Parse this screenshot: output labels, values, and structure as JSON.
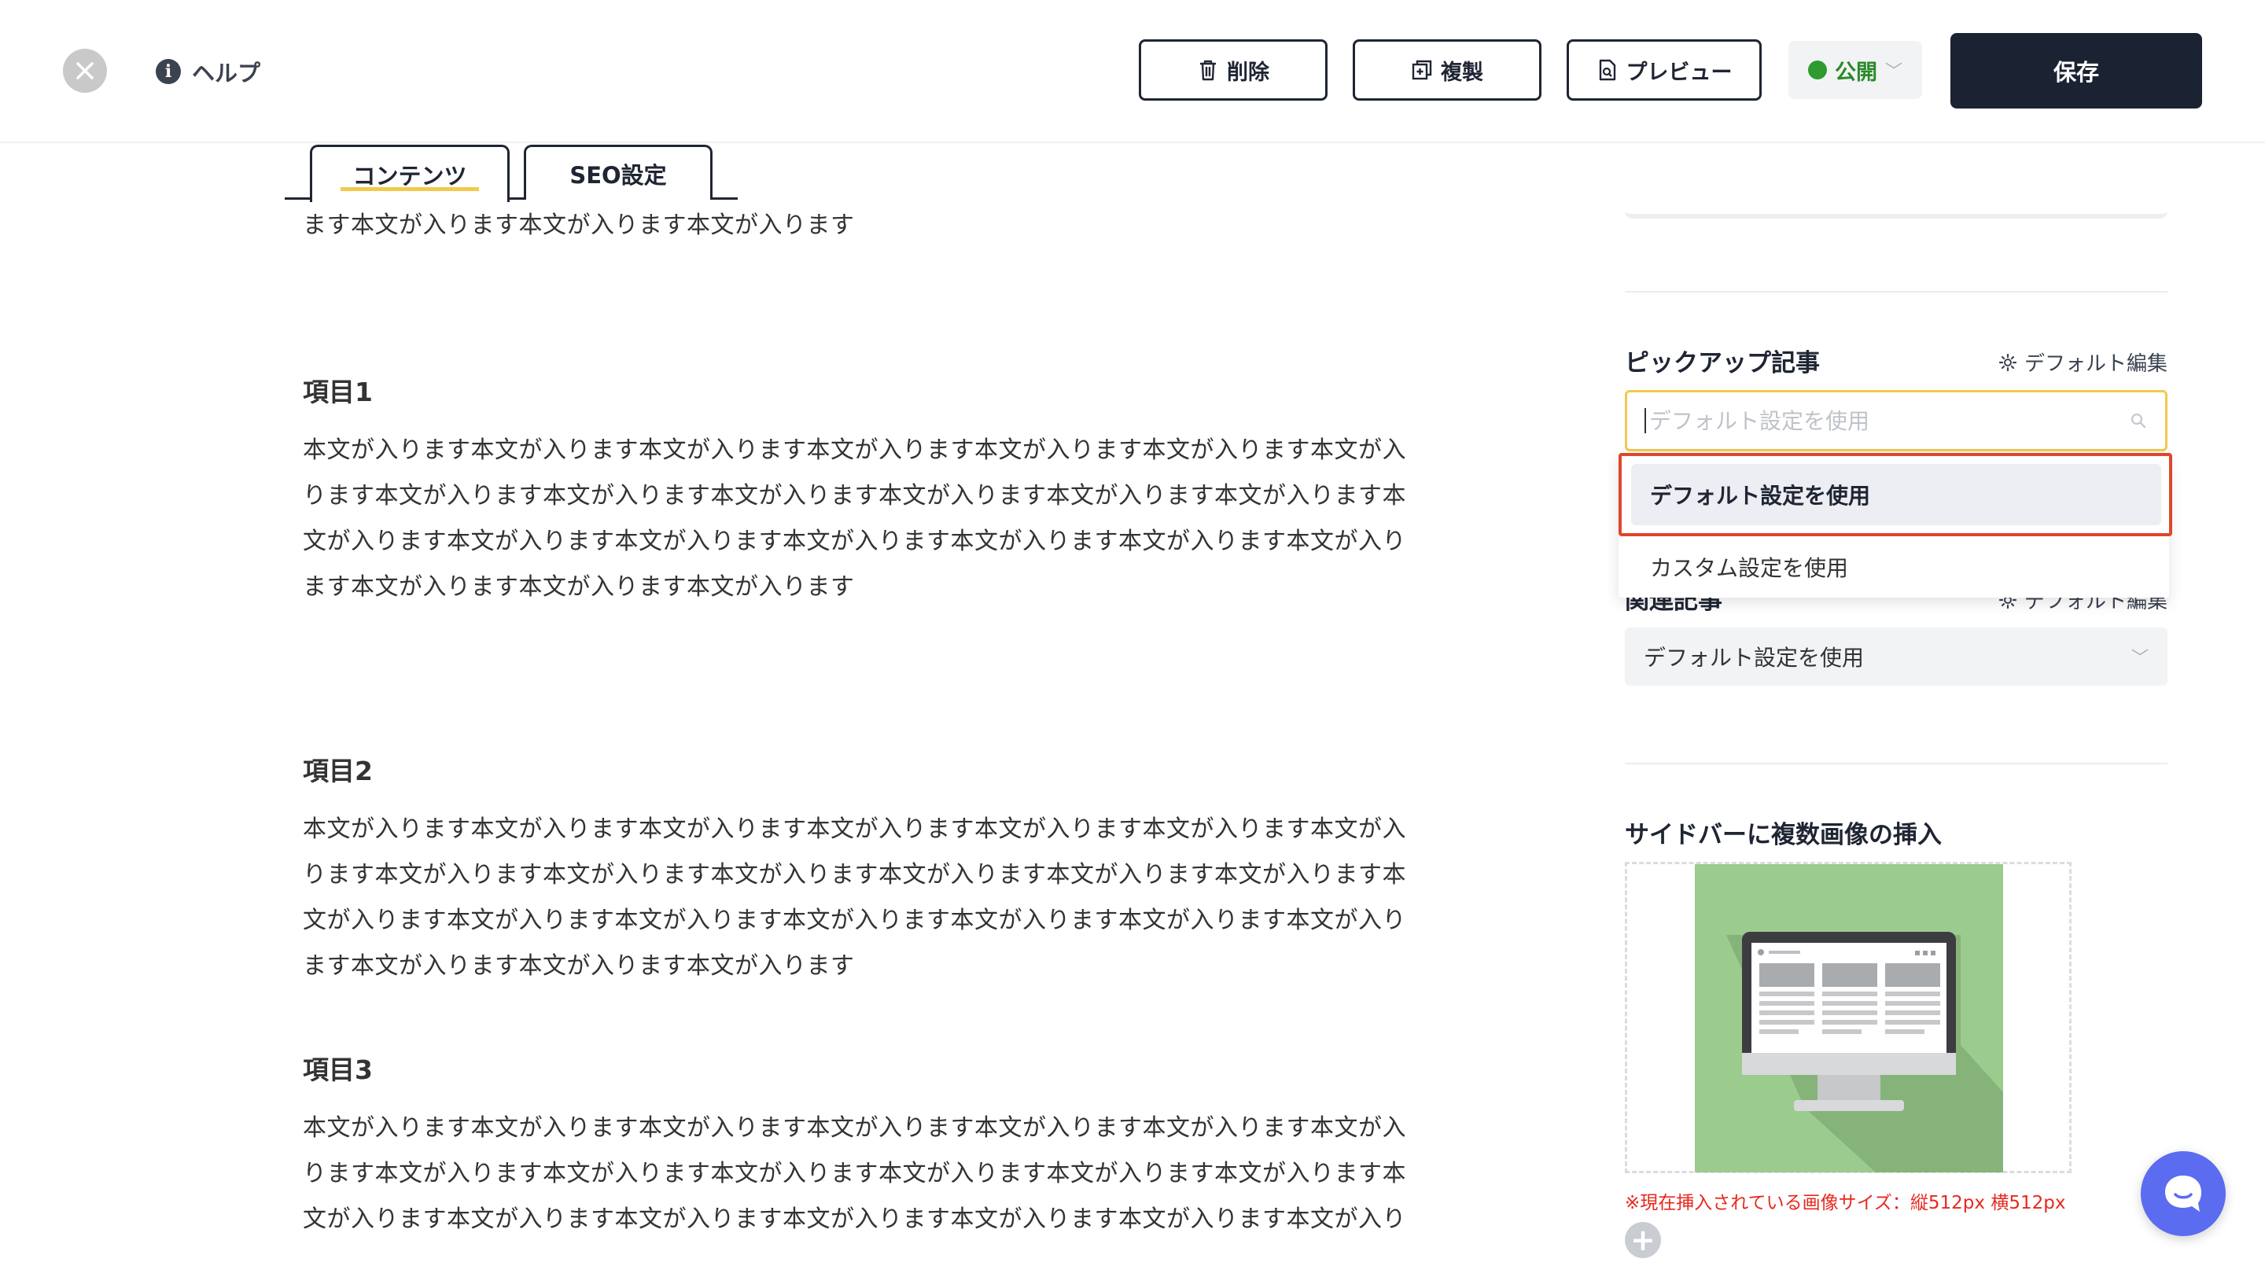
{
  "header": {
    "help_label": "ヘルプ",
    "delete_label": "削除",
    "duplicate_label": "複製",
    "preview_label": "プレビュー",
    "status_label": "公開",
    "save_label": "保存"
  },
  "tabs": [
    {
      "label": "コンテンツ",
      "active": true
    },
    {
      "label": "SEO設定",
      "active": false
    }
  ],
  "article": {
    "intro_tail": "ます本文が入ります本文が入ります本文が入ります",
    "sections": [
      {
        "heading": "項目1",
        "lines": [
          "本文が入ります本文が入ります本文が入ります本文が入ります本文が入ります本文が入ります本文が入",
          "ります本文が入ります本文が入ります本文が入ります本文が入ります本文が入ります本文が入ります本",
          "文が入ります本文が入ります本文が入ります本文が入ります本文が入ります本文が入ります本文が入り",
          "ます本文が入ります本文が入ります本文が入ります"
        ]
      },
      {
        "heading": "項目2",
        "lines": [
          "本文が入ります本文が入ります本文が入ります本文が入ります本文が入ります本文が入ります本文が入",
          "ります本文が入ります本文が入ります本文が入ります本文が入ります本文が入ります本文が入ります本",
          "文が入ります本文が入ります本文が入ります本文が入ります本文が入ります本文が入ります本文が入り",
          "ます本文が入ります本文が入ります本文が入ります"
        ]
      },
      {
        "heading": "項目3",
        "lines": [
          "本文が入ります本文が入ります本文が入ります本文が入ります本文が入ります本文が入ります本文が入",
          "ります本文が入ります本文が入ります本文が入ります本文が入ります本文が入ります本文が入ります本",
          "文が入ります本文が入ります本文が入ります本文が入ります本文が入ります本文が入ります本文が入り"
        ]
      }
    ]
  },
  "sidebar": {
    "pickup": {
      "title": "ピックアップ記事",
      "edit_label": "デフォルト編集",
      "search_placeholder": "デフォルト設定を使用",
      "options": [
        "デフォルト設定を使用",
        "カスタム設定を使用"
      ]
    },
    "related": {
      "title": "関連記事",
      "edit_label": "デフォルト編集",
      "selected": "デフォルト設定を使用"
    },
    "images": {
      "title": "サイドバーに複数画像の挿入",
      "note": "※現在挿入されている画像サイズ：縦512px 横512px"
    }
  },
  "colors": {
    "accent_yellow": "#f2c94c",
    "primary_dark": "#1b2232",
    "publish_green": "#2e9b2e",
    "highlight_red": "#e0462a",
    "chat_blue": "#5b6cf0"
  }
}
